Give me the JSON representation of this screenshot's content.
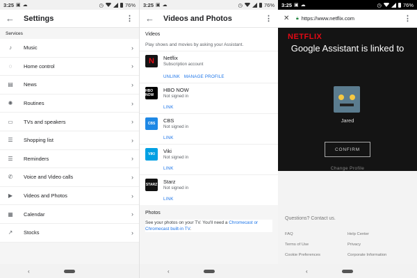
{
  "status_left": {
    "time": "3:25",
    "battery": "76%"
  },
  "status_middle": {
    "time": "3:25",
    "battery": "76%"
  },
  "status_right": {
    "time": "3:25",
    "battery": "76%"
  },
  "settings": {
    "title": "Settings",
    "section": "Services",
    "items": [
      {
        "label": "Music",
        "icon": "music-note-icon",
        "glyph": "♪"
      },
      {
        "label": "Home control",
        "icon": "lightbulb-icon",
        "glyph": "◌"
      },
      {
        "label": "News",
        "icon": "newspaper-icon",
        "glyph": "▤"
      },
      {
        "label": "Routines",
        "icon": "routines-icon",
        "glyph": "✺"
      },
      {
        "label": "TVs and speakers",
        "icon": "cast-icon",
        "glyph": "▭"
      },
      {
        "label": "Shopping list",
        "icon": "list-icon",
        "glyph": "☰"
      },
      {
        "label": "Reminders",
        "icon": "reminders-icon",
        "glyph": "☰"
      },
      {
        "label": "Voice and Video calls",
        "icon": "phone-icon",
        "glyph": "✆"
      },
      {
        "label": "Videos and Photos",
        "icon": "video-icon",
        "glyph": "▶"
      },
      {
        "label": "Calendar",
        "icon": "calendar-icon",
        "glyph": "▦"
      },
      {
        "label": "Stocks",
        "icon": "stocks-icon",
        "glyph": "↗"
      }
    ]
  },
  "videos": {
    "title": "Videos and Photos",
    "section": "Videos",
    "description": "Play shows and movies by asking your Assistant.",
    "services": [
      {
        "name": "Netflix",
        "status": "Subscription account",
        "actions": [
          "UNLINK",
          "MANAGE PROFILE"
        ],
        "logo_text": "N",
        "logo_color": "#141414",
        "logo_fg": "#e50914"
      },
      {
        "name": "HBO NOW",
        "status": "Not signed in",
        "actions": [
          "LINK"
        ],
        "logo_text": "HBO NOW",
        "logo_color": "#000000",
        "logo_fg": "#ffffff"
      },
      {
        "name": "CBS",
        "status": "Not signed in",
        "actions": [
          "LINK"
        ],
        "logo_text": "CBS",
        "logo_color": "#1e88e5",
        "logo_fg": "#ffffff"
      },
      {
        "name": "Viki",
        "status": "Not signed in",
        "actions": [
          "LINK"
        ],
        "logo_text": "VIKI",
        "logo_color": "#00a0e3",
        "logo_fg": "#ffffff"
      },
      {
        "name": "Starz",
        "status": "Not signed in",
        "actions": [
          "LINK"
        ],
        "logo_text": "STARZ",
        "logo_color": "#111111",
        "logo_fg": "#ffffff"
      }
    ],
    "photos_heading": "Photos",
    "photos_text_1": "See your photos on your TV. You'll need a ",
    "photos_link": "Chromecast or Chromecast built-in TV",
    "photos_text_2": "."
  },
  "browser": {
    "url": "https://www.netflix.com",
    "brand": "NETFLIX",
    "heading": "Google Assistant is linked to",
    "profile_name": "Jared",
    "confirm_label": "CONFIRM",
    "change_profile": "Change Profile",
    "questions": "Questions? Contact us.",
    "links": [
      "FAQ",
      "Help Center",
      "Terms of Use",
      "Privacy",
      "Cookie Preferences",
      "Corporate Information"
    ]
  },
  "colors": {
    "accent": "#1a73e8",
    "netflix_red": "#e50914",
    "netflix_bg": "#141414"
  }
}
